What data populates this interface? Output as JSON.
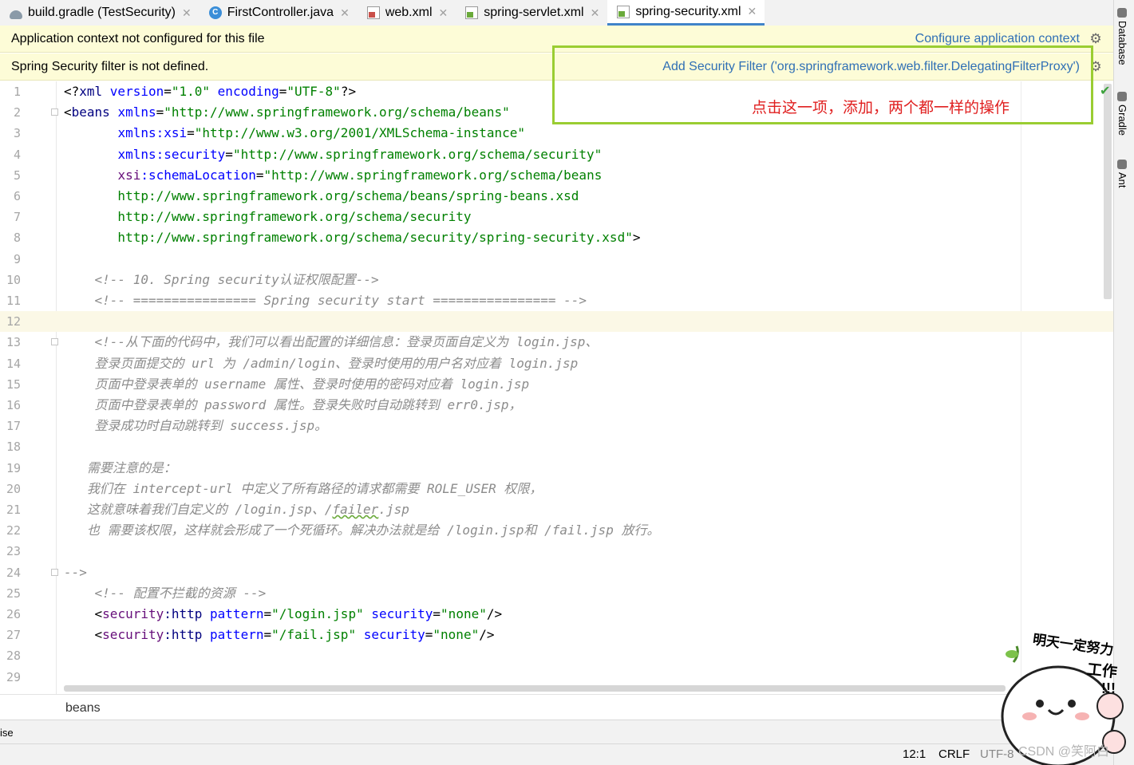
{
  "tabs": [
    {
      "label": "build.gradle (TestSecurity)",
      "icon": "gradle-icon",
      "active": false
    },
    {
      "label": "FirstController.java",
      "icon": "java-class-icon",
      "active": false
    },
    {
      "label": "web.xml",
      "icon": "xml-file-icon",
      "active": false
    },
    {
      "label": "spring-servlet.xml",
      "icon": "spring-xml-icon",
      "active": false
    },
    {
      "label": "spring-security.xml",
      "icon": "spring-xml-icon",
      "active": true
    }
  ],
  "banners": {
    "context": {
      "message": "Application context not configured for this file",
      "action": "Configure application context"
    },
    "filter": {
      "message": "Spring Security filter is not defined.",
      "action": "Add Security Filter ('org.springframework.web.filter.DelegatingFilterProxy')"
    }
  },
  "annotation": {
    "text": "点击这一项，添加，两个都一样的操作",
    "color": "#e02020",
    "box_color": "#9acd32"
  },
  "editor": {
    "current_line": 12,
    "lines": [
      {
        "n": "1",
        "code": [
          {
            "c": "t",
            "v": "<?"
          },
          {
            "c": "tag",
            "v": "xml "
          },
          {
            "c": "attr",
            "v": "version"
          },
          {
            "c": "t",
            "v": "="
          },
          {
            "c": "str",
            "v": "\"1.0\" "
          },
          {
            "c": "attr",
            "v": "encoding"
          },
          {
            "c": "t",
            "v": "="
          },
          {
            "c": "str",
            "v": "\"UTF-8\""
          },
          {
            "c": "t",
            "v": "?>"
          }
        ]
      },
      {
        "n": "2",
        "fold": true,
        "code": [
          {
            "c": "t",
            "v": "<"
          },
          {
            "c": "tag",
            "v": "beans "
          },
          {
            "c": "attr",
            "v": "xmlns"
          },
          {
            "c": "t",
            "v": "="
          },
          {
            "c": "str",
            "v": "\"http://www.springframework.org/schema/beans\""
          }
        ]
      },
      {
        "n": "3",
        "code": [
          {
            "c": "t",
            "v": "       "
          },
          {
            "c": "attr",
            "v": "xmlns:xsi"
          },
          {
            "c": "t",
            "v": "="
          },
          {
            "c": "str",
            "v": "\"http://www.w3.org/2001/XMLSchema-instance\""
          }
        ]
      },
      {
        "n": "4",
        "code": [
          {
            "c": "t",
            "v": "       "
          },
          {
            "c": "attr",
            "v": "xmlns:security"
          },
          {
            "c": "t",
            "v": "="
          },
          {
            "c": "str",
            "v": "\"http://www.springframework.org/schema/security\""
          }
        ]
      },
      {
        "n": "5",
        "code": [
          {
            "c": "t",
            "v": "       "
          },
          {
            "c": "ns",
            "v": "xsi"
          },
          {
            "c": "attr",
            "v": ":schemaLocation"
          },
          {
            "c": "t",
            "v": "="
          },
          {
            "c": "str",
            "v": "\"http://www.springframework.org/schema/beans"
          }
        ]
      },
      {
        "n": "6",
        "code": [
          {
            "c": "str",
            "v": "       http://www.springframework.org/schema/beans/spring-beans.xsd"
          }
        ]
      },
      {
        "n": "7",
        "code": [
          {
            "c": "str",
            "v": "       http://www.springframework.org/schema/security"
          }
        ]
      },
      {
        "n": "8",
        "code": [
          {
            "c": "str",
            "v": "       http://www.springframework.org/schema/security/spring-security.xsd\""
          },
          {
            "c": "t",
            "v": ">"
          }
        ]
      },
      {
        "n": "9",
        "code": []
      },
      {
        "n": "10",
        "code": [
          {
            "c": "cm",
            "v": "    <!-- 10. Spring security认证权限配置-->"
          }
        ]
      },
      {
        "n": "11",
        "code": [
          {
            "c": "cm",
            "v": "    <!-- ================ Spring security start ================ -->"
          }
        ]
      },
      {
        "n": "12",
        "code": []
      },
      {
        "n": "13",
        "fold": true,
        "code": [
          {
            "c": "cm",
            "v": "    <!--从下面的代码中，我们可以看出配置的详细信息：登录页面自定义为 login.jsp、"
          }
        ]
      },
      {
        "n": "14",
        "code": [
          {
            "c": "cm",
            "v": "    登录页面提交的 url 为 /admin/login、登录时使用的用户名对应着 login.jsp"
          }
        ]
      },
      {
        "n": "15",
        "code": [
          {
            "c": "cm",
            "v": "    页面中登录表单的 username 属性、登录时使用的密码对应着 login.jsp"
          }
        ]
      },
      {
        "n": "16",
        "code": [
          {
            "c": "cm",
            "v": "    页面中登录表单的 password 属性。登录失败时自动跳转到 err0.jsp，"
          }
        ]
      },
      {
        "n": "17",
        "code": [
          {
            "c": "cm",
            "v": "    登录成功时自动跳转到 success.jsp。"
          }
        ]
      },
      {
        "n": "18",
        "code": []
      },
      {
        "n": "19",
        "code": [
          {
            "c": "cm",
            "v": "   需要注意的是："
          }
        ]
      },
      {
        "n": "20",
        "code": [
          {
            "c": "cm",
            "v": "   我们在 intercept-url 中定义了所有路径的请求都需要 ROLE_USER 权限，"
          }
        ]
      },
      {
        "n": "21",
        "code": [
          {
            "c": "cm",
            "v": "   这就意味着我们自定义的 /login.jsp、/"
          },
          {
            "c": "cm wavy",
            "v": "failer"
          },
          {
            "c": "cm",
            "v": ".jsp"
          }
        ]
      },
      {
        "n": "22",
        "code": [
          {
            "c": "cm",
            "v": "   也 需要该权限，这样就会形成了一个死循环。解决办法就是给 /login.jsp和 /fail.jsp 放行。"
          }
        ]
      },
      {
        "n": "23",
        "code": []
      },
      {
        "n": "24",
        "fold": true,
        "code": [
          {
            "c": "cm",
            "v": "-->"
          }
        ]
      },
      {
        "n": "25",
        "code": [
          {
            "c": "cm",
            "v": "    <!-- 配置不拦截的资源 -->"
          }
        ]
      },
      {
        "n": "26",
        "code": [
          {
            "c": "t",
            "v": "    <"
          },
          {
            "c": "ns",
            "v": "security"
          },
          {
            "c": "tag",
            "v": ":http "
          },
          {
            "c": "attr",
            "v": "pattern"
          },
          {
            "c": "t",
            "v": "="
          },
          {
            "c": "str",
            "v": "\"/login.jsp\" "
          },
          {
            "c": "attr",
            "v": "security"
          },
          {
            "c": "t",
            "v": "="
          },
          {
            "c": "str",
            "v": "\"none\""
          },
          {
            "c": "t",
            "v": "/>"
          }
        ]
      },
      {
        "n": "27",
        "code": [
          {
            "c": "t",
            "v": "    <"
          },
          {
            "c": "ns",
            "v": "security"
          },
          {
            "c": "tag",
            "v": ":http "
          },
          {
            "c": "attr",
            "v": "pattern"
          },
          {
            "c": "t",
            "v": "="
          },
          {
            "c": "str",
            "v": "\"/fail.jsp\" "
          },
          {
            "c": "attr",
            "v": "security"
          },
          {
            "c": "t",
            "v": "="
          },
          {
            "c": "str",
            "v": "\"none\""
          },
          {
            "c": "t",
            "v": "/>"
          }
        ]
      },
      {
        "n": "28",
        "code": []
      },
      {
        "n": "29",
        "code": []
      }
    ]
  },
  "breadcrumb": "beans",
  "bottom_tool_left": "ise",
  "status": {
    "position": "12:1",
    "line_separator": "CRLF",
    "encoding": "UTF-8"
  },
  "right_tools": [
    "Database",
    "Gradle",
    "Ant"
  ],
  "sticker": {
    "line1": "明天一定努力",
    "line2": "工作",
    "line3": "!!!"
  },
  "watermark": "CSDN @笑阿白"
}
